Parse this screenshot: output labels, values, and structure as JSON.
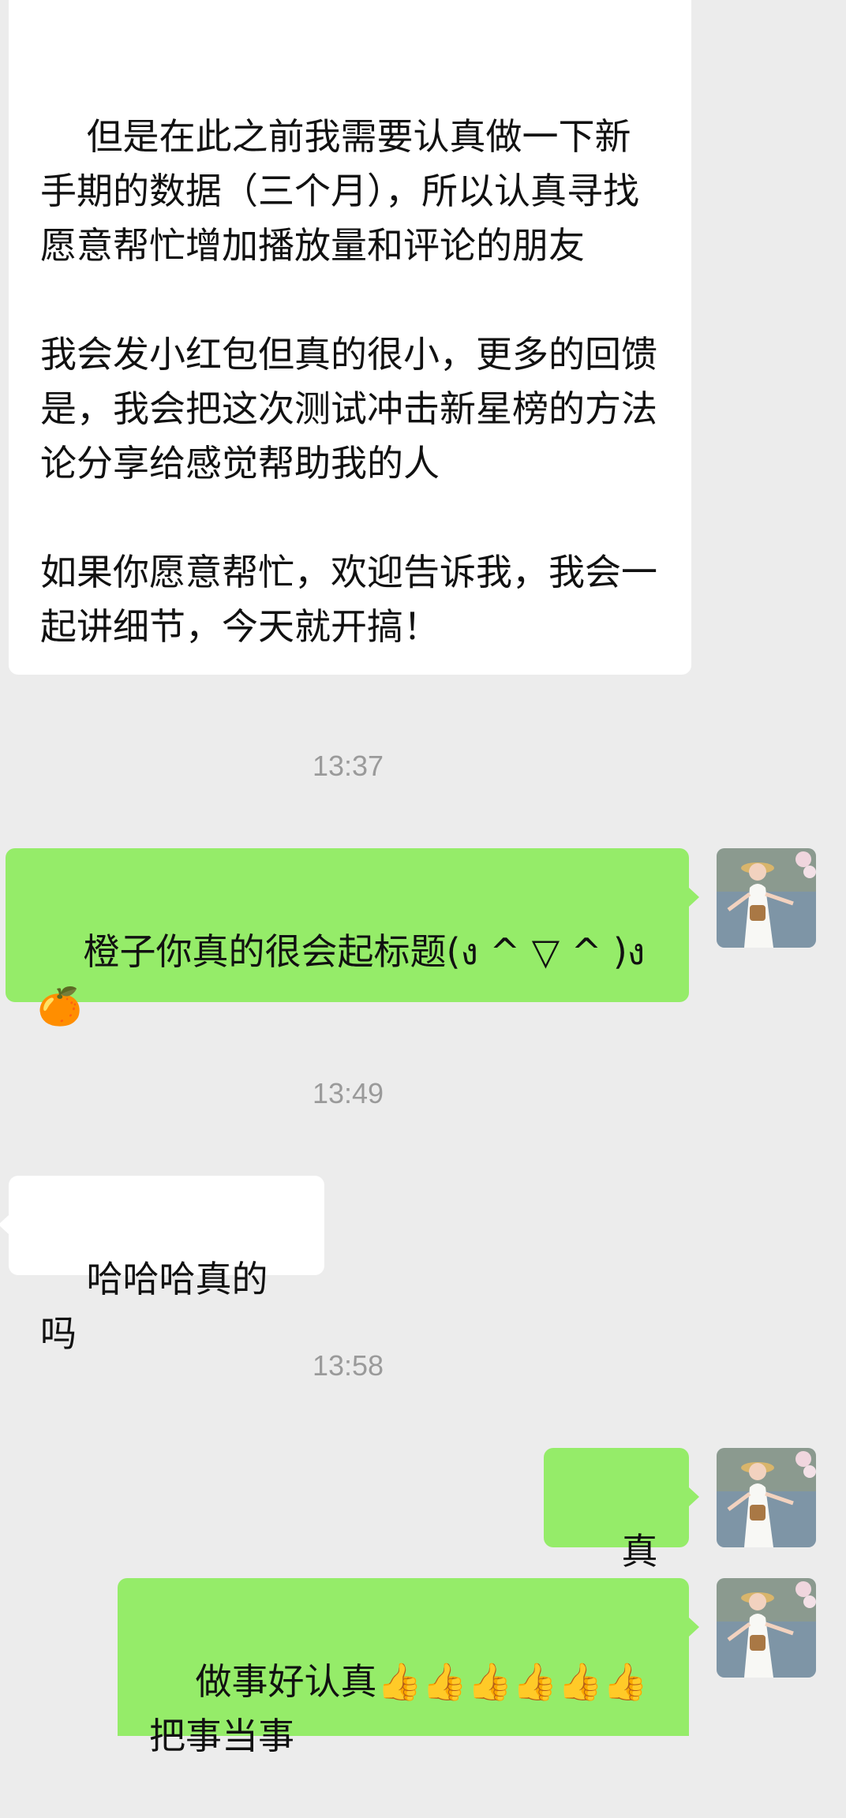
{
  "messages": [
    {
      "sender": "other",
      "text": "但是在此之前我需要认真做一下新手期的数据（三个月），所以认真寻找愿意帮忙增加播放量和评论的朋友\n\n我会发小红包但真的很小，更多的回馈是，我会把这次测试冲击新星榜的方法论分享给感觉帮助我的人\n\n如果你愿意帮忙，欢迎告诉我，我会一起讲细节，今天就开搞！"
    },
    {
      "timestamp": "13:37"
    },
    {
      "sender": "me",
      "text": "橙子你真的很会起标题(ง ^ ▽ ^ )ง🍊"
    },
    {
      "timestamp": "13:49"
    },
    {
      "sender": "other",
      "text": "哈哈哈真的吗"
    },
    {
      "timestamp": "13:58"
    },
    {
      "sender": "me",
      "text": "真的"
    },
    {
      "sender": "me",
      "text": "做事好认真👍👍👍👍👍👍把事当事"
    }
  ],
  "colors": {
    "background": "#ececec",
    "bubble_incoming": "#ffffff",
    "bubble_outgoing": "#95ec69",
    "timestamp": "#9a9a9a"
  },
  "icons": {
    "avatar": "avatar-icon"
  }
}
